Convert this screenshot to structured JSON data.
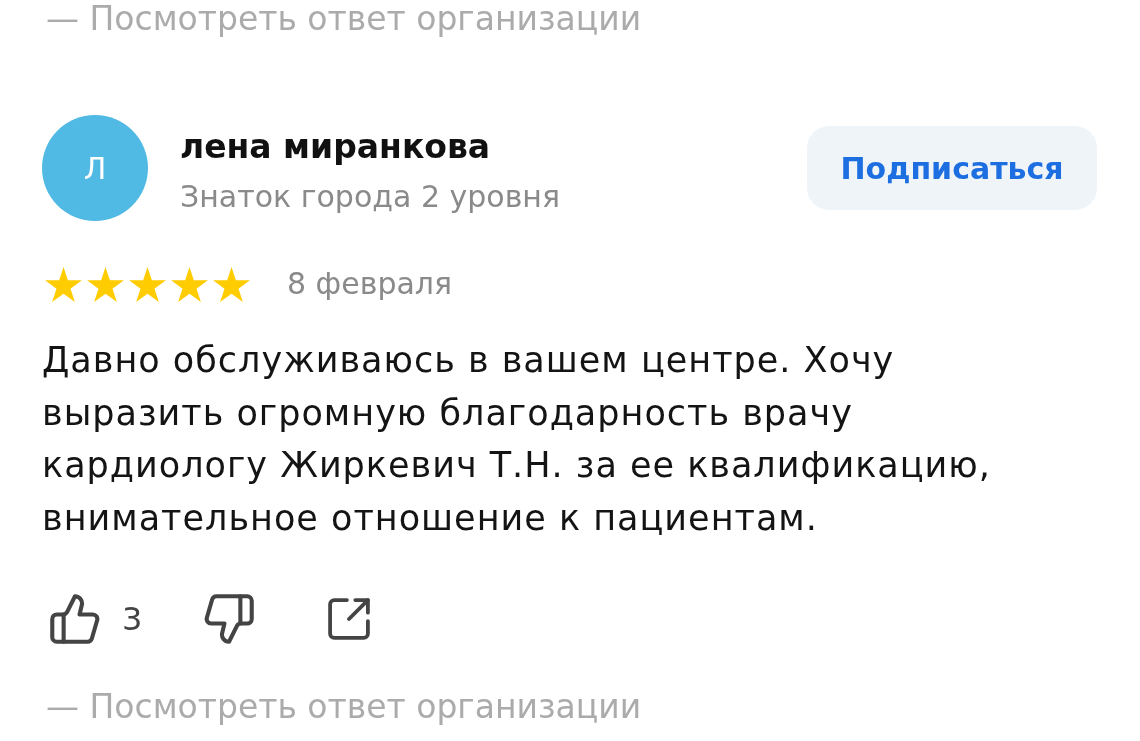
{
  "previous_review": {
    "answer_link": "— Посмотреть ответ организации"
  },
  "review": {
    "author": {
      "initial": "Л",
      "name": "лена миранкова",
      "status": "Знаток города 2 уровня"
    },
    "subscribe_button": "Подписаться",
    "stars": 5,
    "date": "8 февраля",
    "text": "Давно обслуживаюсь в вашем центре. Хочу выразить огромную благодарность врачу кардиологу Жиркевич Т.Н. за ее квалификацию, внимательное отношение к пациентам.",
    "actions": [
      {
        "kind": "like",
        "count": "3"
      },
      {
        "kind": "dislike"
      },
      {
        "kind": "share"
      }
    ],
    "answer_link": "— Посмотреть ответ организации"
  }
}
